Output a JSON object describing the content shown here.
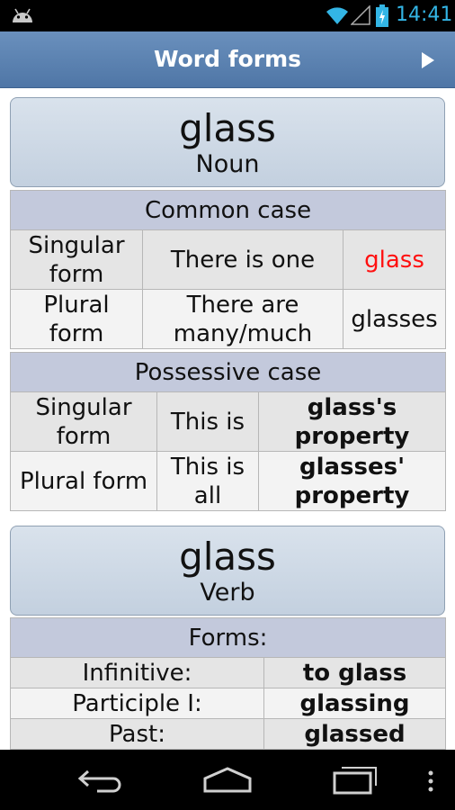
{
  "status_bar": {
    "time": "14:41",
    "icons": [
      "android-icon",
      "wifi-icon",
      "signal-icon",
      "battery-icon"
    ],
    "accent_color": "#33b5e5"
  },
  "action_bar": {
    "title": "Word forms",
    "play_icon": "play-icon",
    "background": "#5a80b0"
  },
  "noun_card": {
    "word": "glass",
    "part_of_speech": "Noun"
  },
  "common_case": {
    "header": "Common case",
    "rows": [
      {
        "label": "Singular form",
        "description": "There is one",
        "value": "glass"
      },
      {
        "label": "Plural form",
        "description": "There are many/much",
        "value": "glasses"
      }
    ]
  },
  "possessive_case": {
    "header": "Possessive case",
    "rows": [
      {
        "label": "Singular form",
        "description": "This is",
        "value": "glass's property"
      },
      {
        "label": "Plural form",
        "description": "This is all",
        "value": "glasses' property"
      }
    ]
  },
  "verb_card": {
    "word": "glass",
    "part_of_speech": "Verb"
  },
  "verb_forms": {
    "header": "Forms:",
    "rows": [
      {
        "label": "Infinitive:",
        "value": "to glass"
      },
      {
        "label": "Participle I:",
        "value": "glassing"
      },
      {
        "label": "Past:",
        "value": "glassed"
      }
    ]
  },
  "nav_bar": {
    "icons": [
      "back-icon",
      "home-icon",
      "recent-apps-icon",
      "overflow-menu-icon"
    ]
  },
  "highlight_color": "#ff1010"
}
